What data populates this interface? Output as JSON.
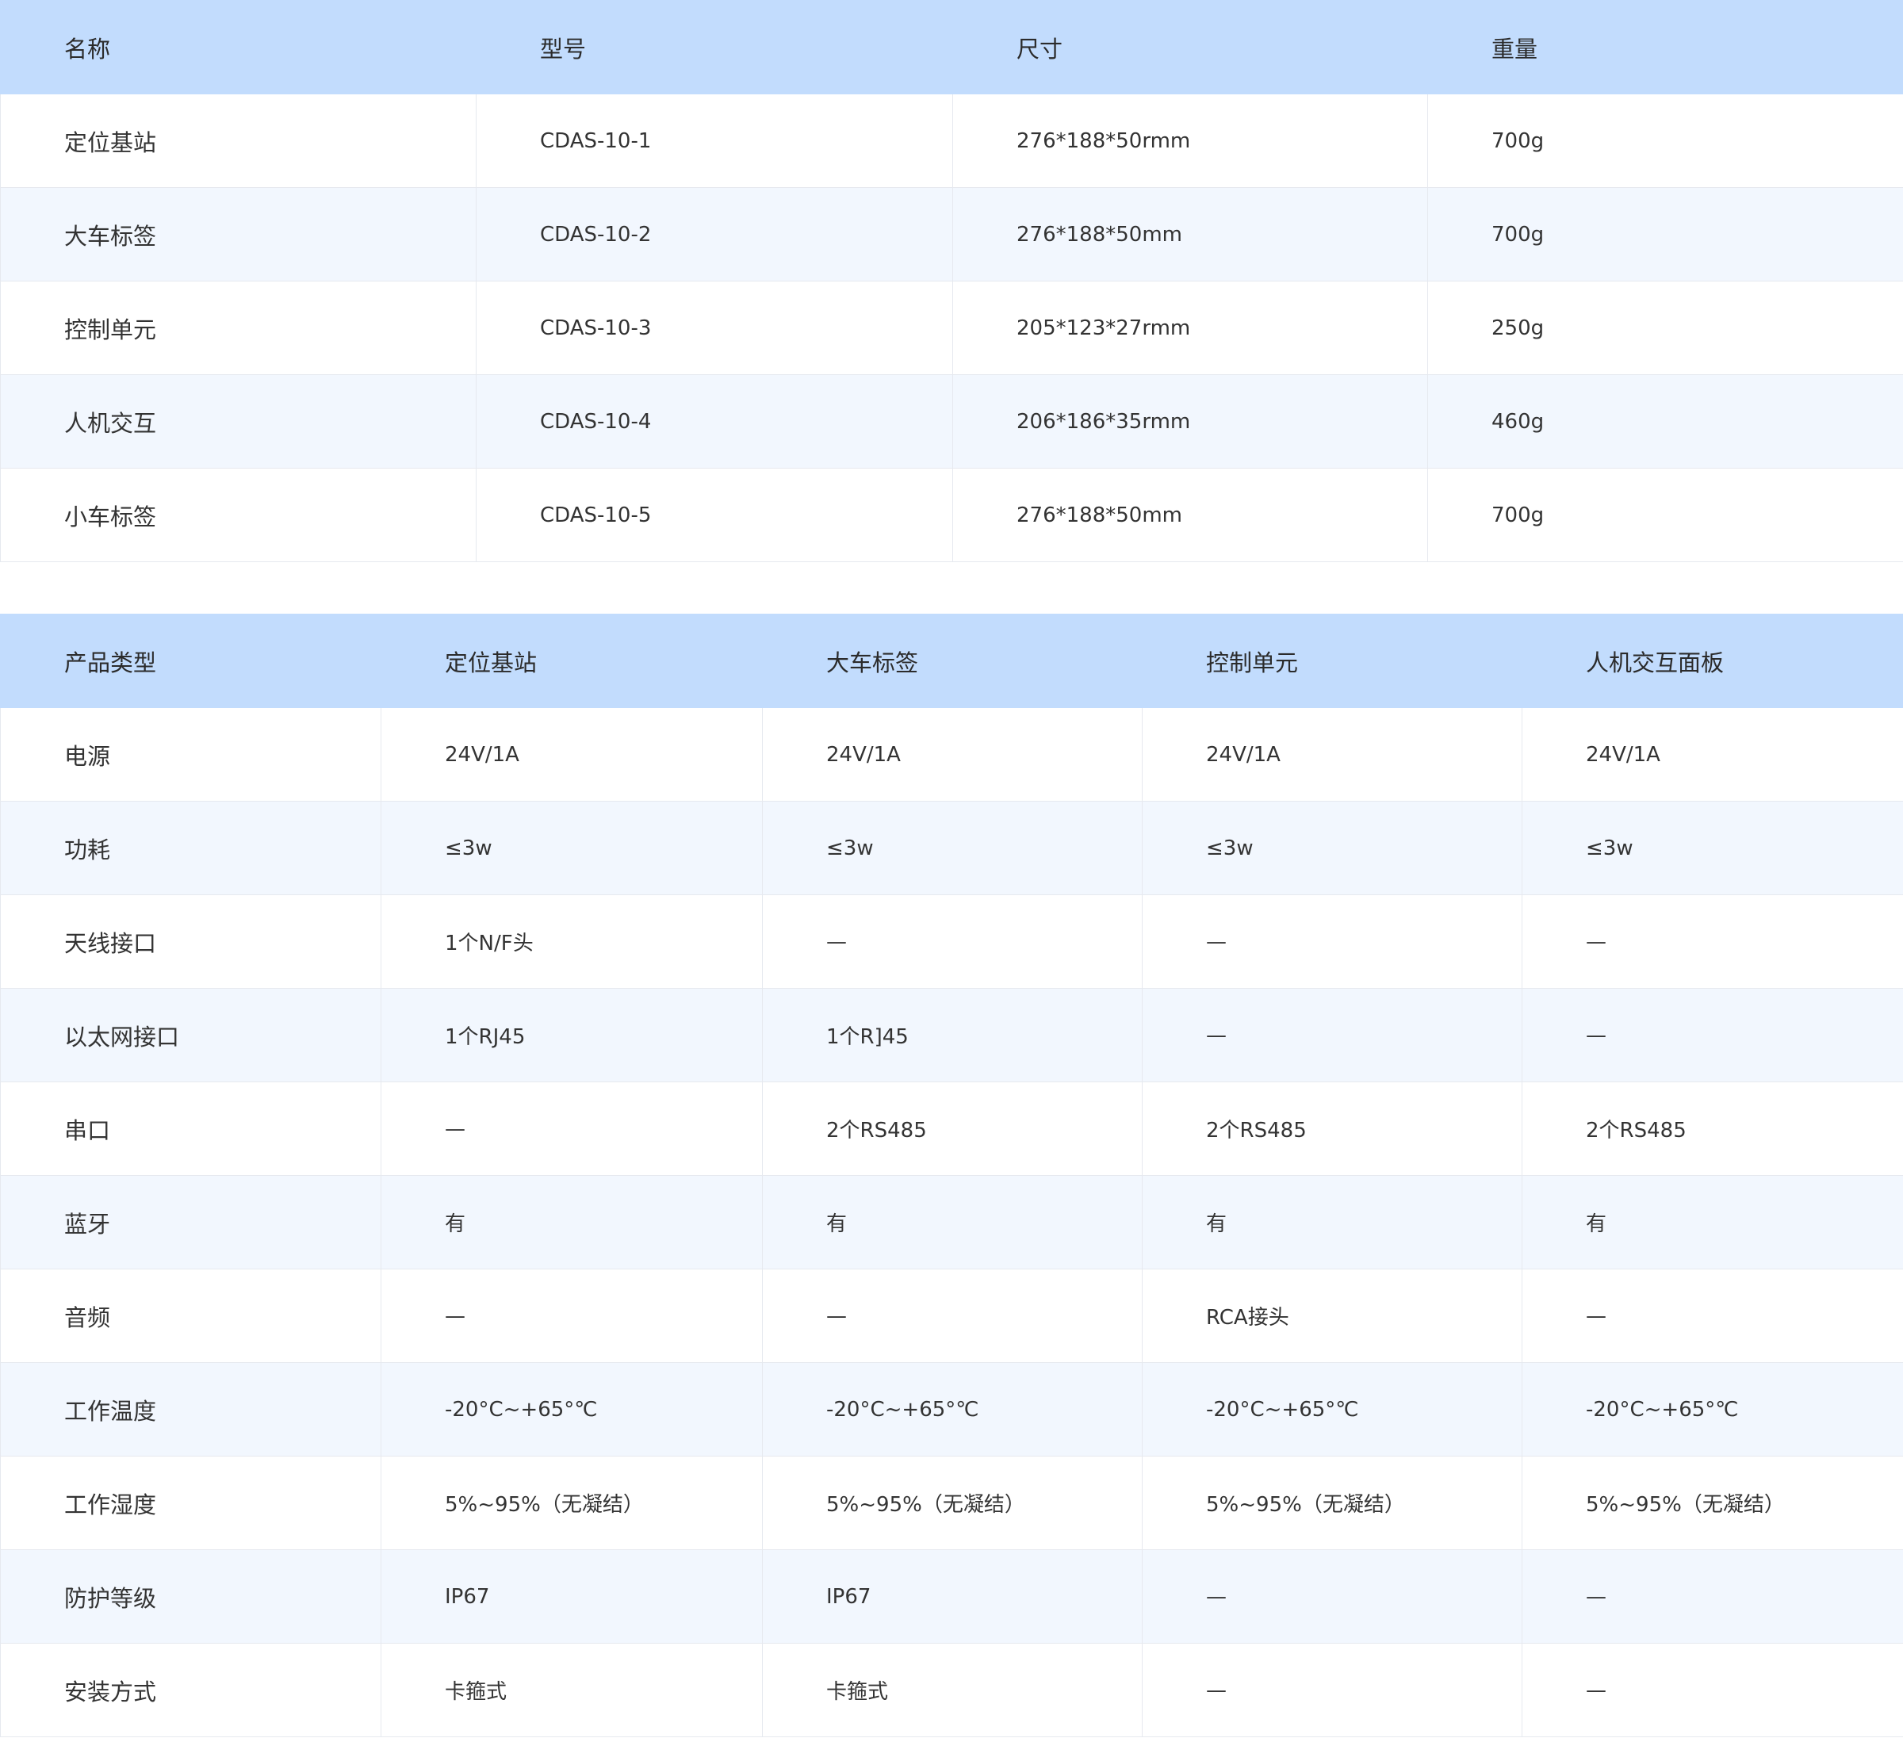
{
  "table1": {
    "headers": [
      "名称",
      "型号",
      "尺寸",
      "重量"
    ],
    "rows": [
      [
        "定位基站",
        "CDAS-10-1",
        "276*188*50rmm",
        "700g"
      ],
      [
        "大车标签",
        "CDAS-10-2",
        "276*188*50mm",
        "700g"
      ],
      [
        "控制单元",
        "CDAS-10-3",
        "205*123*27rmm",
        "250g"
      ],
      [
        "人机交互",
        "CDAS-10-4",
        "206*186*35rmm",
        "460g"
      ],
      [
        "小车标签",
        "CDAS-10-5",
        "276*188*50mm",
        "700g"
      ]
    ]
  },
  "table2": {
    "headers": [
      "产品类型",
      "定位基站",
      "大车标签",
      "控制单元",
      "人机交互面板"
    ],
    "rows": [
      [
        "电源",
        "24V/1A",
        "24V/1A",
        "24V/1A",
        "24V/1A"
      ],
      [
        "功耗",
        "≤3w",
        "≤3w",
        "≤3w",
        "≤3w"
      ],
      [
        "天线接口",
        "1个N/F头",
        "—",
        "—",
        "—"
      ],
      [
        "以太网接口",
        "1个RJ45",
        "1个R]45",
        "—",
        "—"
      ],
      [
        "串口",
        "—",
        "2个RS485",
        "2个RS485",
        "2个RS485"
      ],
      [
        "蓝牙",
        "有",
        "有",
        "有",
        "有"
      ],
      [
        "音频",
        "—",
        "—",
        "RCA接头",
        "—"
      ],
      [
        "工作温度",
        "-20°C~+65°℃",
        "-20°C~+65°℃",
        "-20°C~+65°℃",
        "-20°C~+65°℃"
      ],
      [
        "工作湿度",
        "5%~95%（无凝结）",
        "5%~95%（无凝结）",
        "5%~95%（无凝结）",
        "5%~95%（无凝结）"
      ],
      [
        "防护等级",
        "IP67",
        "IP67",
        "—",
        "—"
      ],
      [
        "安装方式",
        "卡箍式",
        "卡箍式",
        "—",
        "—"
      ]
    ]
  }
}
